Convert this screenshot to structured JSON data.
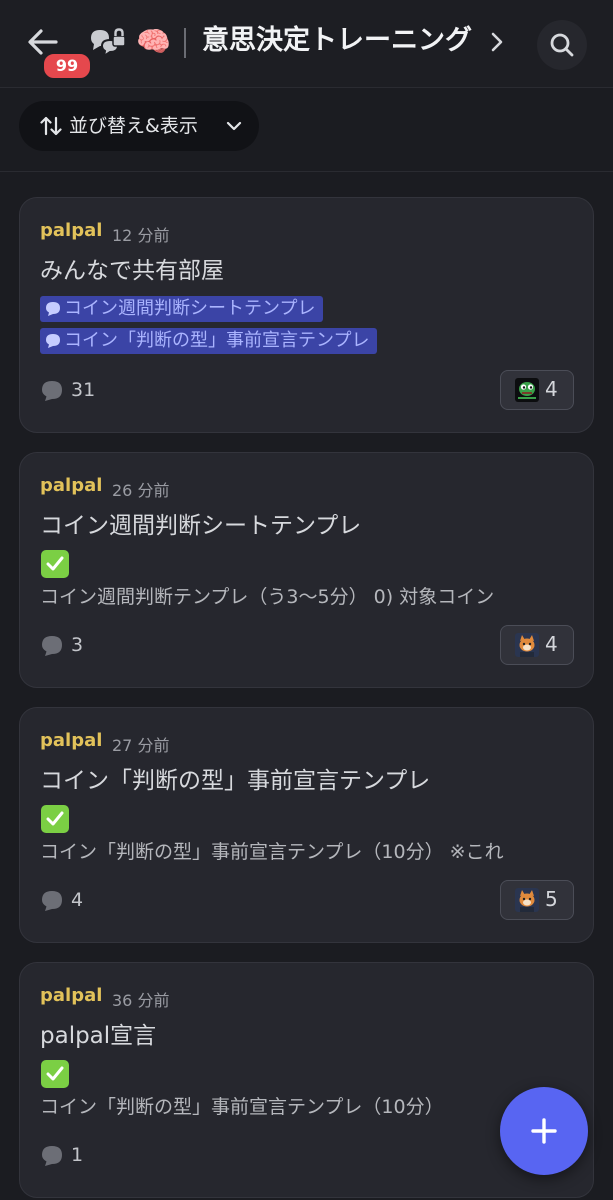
{
  "header": {
    "badge_count": "99",
    "emoji": "🧠",
    "channel_title": "意思決定トレーニング"
  },
  "toolbar": {
    "sort_label": "並び替え&表示"
  },
  "posts": [
    {
      "author": "palpal",
      "time": "12 分前",
      "title": "みんなで共有部屋",
      "mentions": [
        "コイン週間判断シートテンプレ",
        "コイン「判断の型」事前宣言テンプレ"
      ],
      "replies": "31",
      "reaction_count": "4"
    },
    {
      "author": "palpal",
      "time": "26 分前",
      "title": "コイン週間判断シートテンプレ",
      "preview": " コイン週間判断テンプレ（う3〜5分） 0) 対象コイン",
      "replies": "3",
      "reaction_count": "4"
    },
    {
      "author": "palpal",
      "time": "27 分前",
      "title": "コイン「判断の型」事前宣言テンプレ",
      "preview": "コイン「判断の型」事前宣言テンプレ（10分） ※これ",
      "replies": "4",
      "reaction_count": "5"
    },
    {
      "author": "palpal",
      "time": "36 分前",
      "title": "palpal宣言",
      "preview": "コイン「判断の型」事前宣言テンプレ（10分）",
      "replies": "1"
    }
  ],
  "colors": {
    "background": "#1b1c21",
    "card": "#26272e",
    "author": "#e2c25a",
    "accent": "#5865f2",
    "badge": "#e5484d",
    "mention_bg": "#3b44a6"
  }
}
